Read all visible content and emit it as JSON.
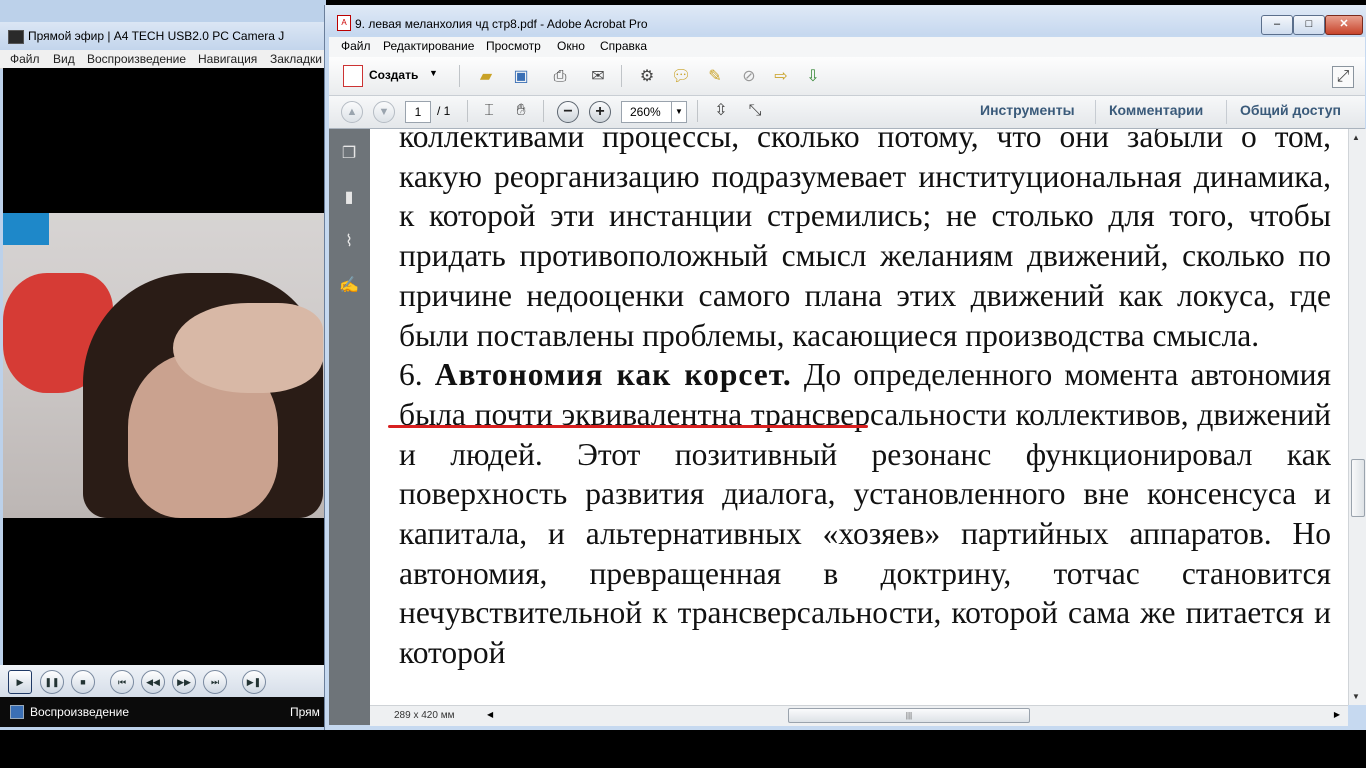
{
  "media_player": {
    "title": "Прямой эфир | A4 TECH USB2.0 PC Camera J",
    "menu": [
      "Файл",
      "Вид",
      "Воспроизведение",
      "Навигация",
      "Закладки"
    ],
    "controls": [
      "play",
      "pause",
      "stop",
      "previous",
      "rewind",
      "forward",
      "next",
      "frame-step"
    ],
    "status_left": "Воспроизведение",
    "status_right": "Прям"
  },
  "acrobat": {
    "title": "9. левая меланхолия чд стр8.pdf - Adobe Acrobat Pro",
    "menu": [
      "Файл",
      "Редактирование",
      "Просмотр",
      "Окно",
      "Справка"
    ],
    "create_label": "Создать",
    "page_current": "1",
    "page_total": "/ 1",
    "zoom": "260%",
    "right_buttons": [
      "Инструменты",
      "Комментарии",
      "Общий доступ"
    ],
    "page_size": "289 x 420 мм",
    "window_buttons": [
      "–",
      "□",
      "✕"
    ]
  },
  "document": {
    "p1": "коллективами процессы, сколько потому, что они забыли о том, какую реорганизацию подразумевает институциональная динамика, к которой эти инстанции стремились; не столько для того, чтобы придать противоположный смысл желаниям движений, сколько по причине недооценки самого плана этих движений как локуса, где были поставлены проблемы, касающиеся производства смысла.",
    "p2_num": "6.",
    "p2_heading": "Автономия как корсет.",
    "p2_body": "До определенного момента автономия была почти эквивалентна трансверсальности коллективов, движений и людей. Этот позитивный резонанс функционировал как поверхность развития диалога, установленного вне консенсуса и капитала, и альтернативных «хозяев» партийных аппаратов. Но автономия, превращенная в доктрину, тотчас становится нечувствительной к трансверсальности, которой сама же питается и которой"
  }
}
